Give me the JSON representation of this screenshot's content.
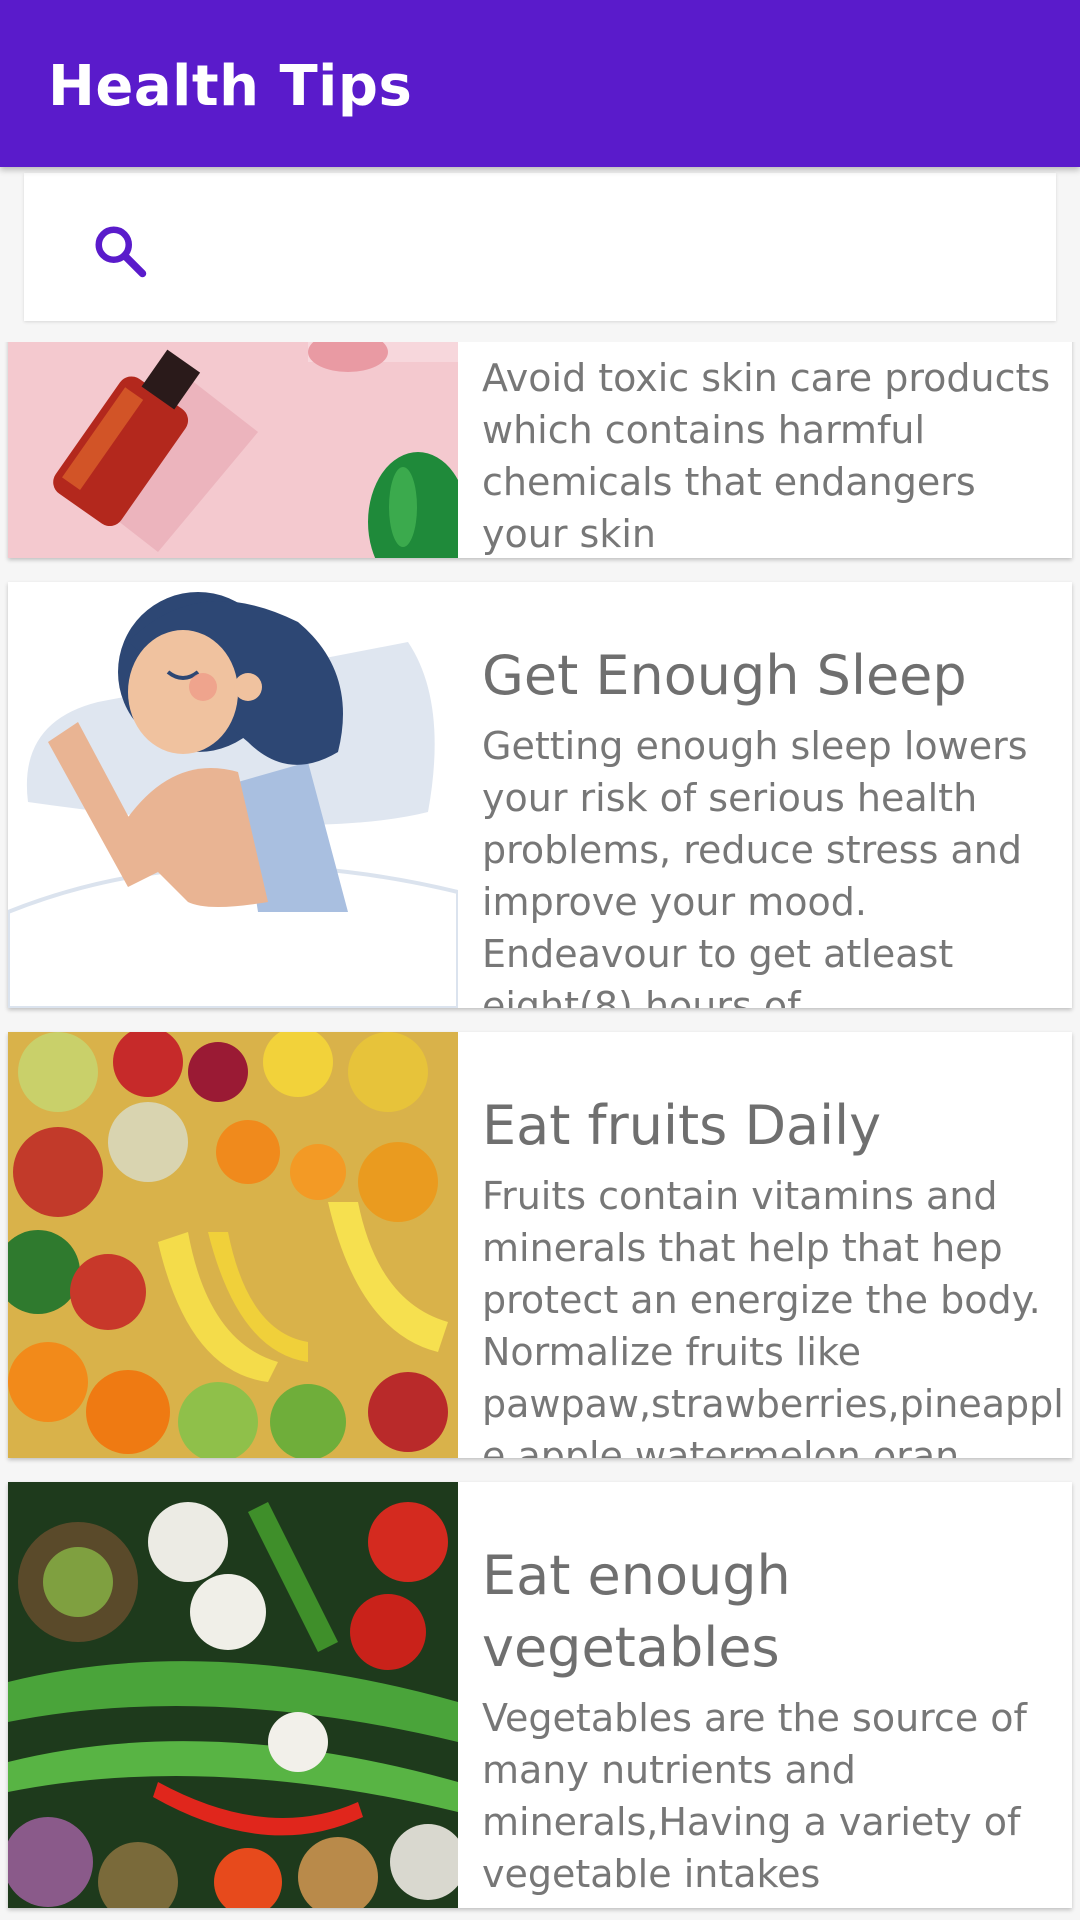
{
  "app": {
    "title": "Health Tips"
  },
  "search": {
    "placeholder": "",
    "value": ""
  },
  "icons": {
    "search": "search-icon"
  },
  "colors": {
    "primary": "#5a1bcb",
    "background": "#f6f6f6",
    "card": "#ffffff",
    "text": "#777777"
  },
  "tips": [
    {
      "title": "",
      "description": "Avoid toxic skin care products which contains harmful chemicals that endangers your skin",
      "image": "skin-care-bottles-image"
    },
    {
      "title": "Get Enough Sleep",
      "description": "Getting enough sleep lowers your risk of serious health problems, reduce stress and improve your mood. Endeavour to get atleast eight(8) hours of",
      "image": "sleeping-girl-image"
    },
    {
      "title": "Eat fruits Daily",
      "description": "Fruits contain vitamins and minerals that help that hep protect an energize the body. Normalize fruits like pawpaw,strawberries,pineapple,apple,watermelon,oran",
      "image": "fruits-image"
    },
    {
      "title": "Eat enough vegetables",
      "description": "Vegetables are the source of many nutrients and minerals,Having a variety of vegetable intakes",
      "image": "vegetables-image"
    }
  ]
}
